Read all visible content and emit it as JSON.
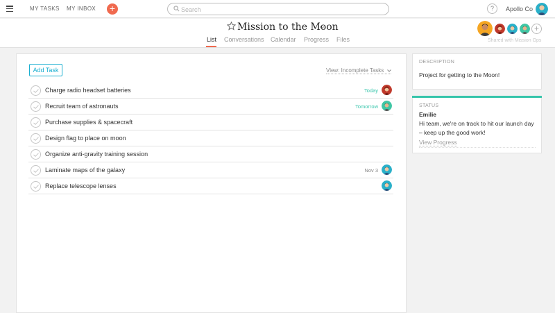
{
  "topbar": {
    "my_tasks": "MY TASKS",
    "my_inbox": "MY INBOX",
    "add_symbol": "+",
    "search_placeholder": "Search",
    "help_symbol": "?",
    "org_name": "Apollo Co",
    "accent_color": "#f06a4f"
  },
  "project": {
    "title": "Mission to the Moon",
    "tabs": [
      "List",
      "Conversations",
      "Calendar",
      "Progress",
      "Files"
    ],
    "active_tab": "List",
    "members_note": "Shared with Mission Ops",
    "add_member_symbol": "+"
  },
  "list": {
    "add_task_label": "Add Task",
    "view_label": "View: Incomplete Tasks",
    "tasks": [
      {
        "name": "Charge radio headset batteries",
        "due": "Today",
        "due_color": "#37c5ab",
        "assignee": "red-haired-avatar"
      },
      {
        "name": "Recruit team of astronauts",
        "due": "Tomorrow",
        "due_color": "#37c5ab",
        "assignee": "green-avatar"
      },
      {
        "name": "Purchase supplies & spacecraft",
        "due": "",
        "assignee": ""
      },
      {
        "name": "Design flag to place on moon",
        "due": "",
        "assignee": ""
      },
      {
        "name": "Organize anti-gravity training session",
        "due": "",
        "assignee": ""
      },
      {
        "name": "Laminate maps of the galaxy",
        "due": "Nov 3",
        "due_color": "#888888",
        "assignee": "teal-avatar"
      },
      {
        "name": "Replace telescope lenses",
        "due": "",
        "assignee": "teal-avatar"
      }
    ]
  },
  "description": {
    "label": "DESCRIPTION",
    "text": "Project for getting to the Moon!"
  },
  "status": {
    "label": "STATUS",
    "author": "Emilie",
    "text": "Hi team, we're on track to hit our launch day – keep up the good work!",
    "link": "View Progress",
    "color": "#37c5ab"
  }
}
